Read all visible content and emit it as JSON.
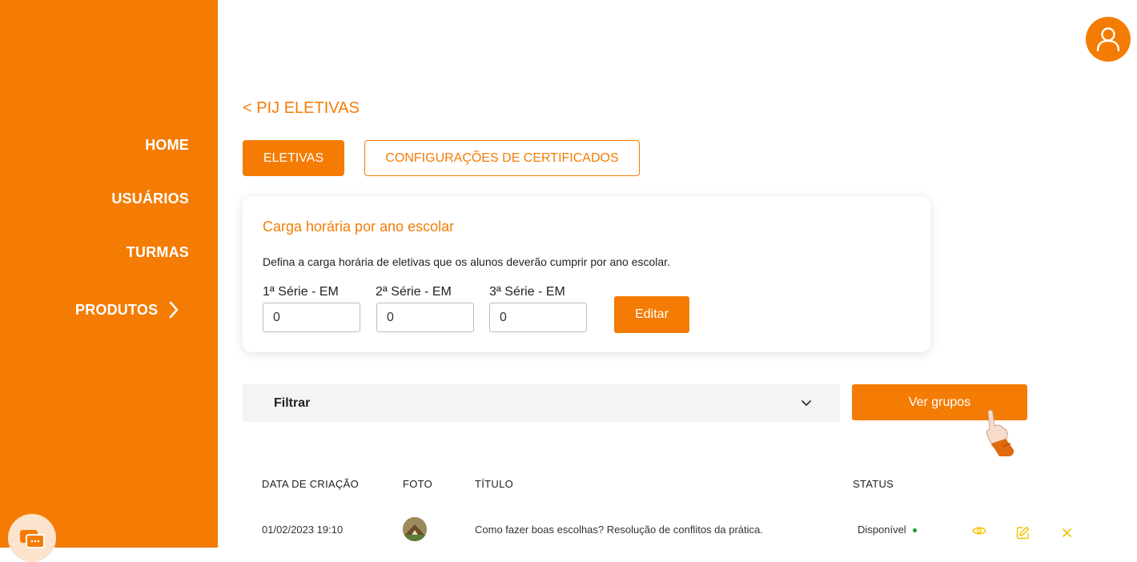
{
  "sidebar": {
    "items": [
      {
        "label": "HOME"
      },
      {
        "label": "USUÁRIOS"
      },
      {
        "label": "TURMAS"
      },
      {
        "label": "PRODUTOS"
      }
    ]
  },
  "header": {
    "breadcrumb": "< PIJ ELETIVAS",
    "tabs": [
      {
        "label": "ELETIVAS",
        "active": true
      },
      {
        "label": "CONFIGURAÇÕES DE CERTIFICADOS",
        "active": false
      }
    ]
  },
  "workload_card": {
    "title": "Carga horária por ano escolar",
    "description": "Defina a carga horária de eletivas que os alunos deverão cumprir por ano escolar.",
    "fields": [
      {
        "label": "1ª Série - EM",
        "value": "0"
      },
      {
        "label": "2ª Série - EM",
        "value": "0"
      },
      {
        "label": "3ª Série - EM",
        "value": "0"
      }
    ],
    "edit_label": "Editar"
  },
  "filter": {
    "label": "Filtrar",
    "icon": "chevron-down-icon"
  },
  "groups_button": {
    "label": "Ver grupos"
  },
  "table": {
    "columns": [
      "DATA DE CRIAÇÃO",
      "FOTO",
      "TÍTULO",
      "STATUS"
    ],
    "rows": [
      {
        "date": "01/02/2023 19:10",
        "title": "Como fazer boas escolhas? Resolução de conflitos da prática.",
        "status": "Disponível",
        "actions": [
          "eye-icon",
          "edit-icon",
          "close-icon"
        ]
      }
    ]
  },
  "colors": {
    "accent": "#f47c04",
    "status_available": "#1a9b2e",
    "action_icon": "#f2c200"
  }
}
